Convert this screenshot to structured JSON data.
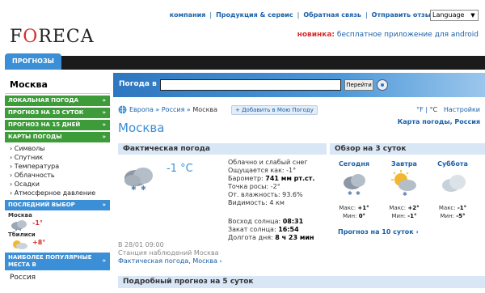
{
  "toplinks": [
    "компания",
    "Продукция & сервис",
    "Обратная связь",
    "Отправить отзыв"
  ],
  "language": "Language",
  "logo": "FORECA",
  "promo": {
    "new": "новинка:",
    "text": " бесплатное приложение для android"
  },
  "tab": "ПРОГНОЗЫ",
  "search": {
    "label": "Погода в",
    "button": "Перейти"
  },
  "sidebar": {
    "city": "Москва",
    "green": [
      {
        "label": "ЛОКАЛЬНАЯ ПОГОДА"
      },
      {
        "label": "ПРОГНОЗ НА 10 СУТОК"
      },
      {
        "label": "ПРОГНОЗ НА 15 ДНЕЙ"
      },
      {
        "label": "КАРТЫ ПОГОДЫ"
      }
    ],
    "sub": [
      "› Символы",
      "› Спутник",
      "› Температура",
      "› Облачность",
      "› Осадки",
      "› Атмосферное давление"
    ],
    "recent_title": "ПОСЛЕДНИЙ ВЫБОР",
    "recent": [
      {
        "name": "Москва",
        "temp": "-1°"
      },
      {
        "name": "Тбилиси",
        "temp": "+8°"
      }
    ],
    "popular_title": "НАИБОЛЕЕ ПОПУЛЯРНЫЕ МЕСТА В",
    "popular_country": "Россия"
  },
  "breadcrumb": {
    "path1": "Европа",
    "path2": "Россия",
    "current": "Москва",
    "favorite": "+ Добавить в Мою Погоду",
    "unit_f": "°F",
    "unit_c": "°C",
    "settings": "Настройки"
  },
  "title": "Москва",
  "maplink": "Карта погоды, Россия",
  "current": {
    "heading": "Фактическая погода",
    "temp": "-1 °C",
    "details": [
      {
        "label": "Облачно и слабый снег",
        "value": ""
      },
      {
        "label": "Ощущается как: ",
        "value": "-1°"
      },
      {
        "label": "Барометр: ",
        "value": "741 мм рт.ст."
      },
      {
        "label": "Точка росы: ",
        "value": "-2°"
      },
      {
        "label": "От. влажность: ",
        "value": "93.6%"
      },
      {
        "label": "Видимость: ",
        "value": "4 км"
      }
    ],
    "sun": [
      {
        "label": "Восход солнца: ",
        "value": "08:31"
      },
      {
        "label": "Закат солнца: ",
        "value": "16:54"
      },
      {
        "label": "Долгота дня: ",
        "value": "8 ч 23 мин"
      }
    ],
    "time": "В 28/01 09:00",
    "station": "Станция наблюдений Москва",
    "link": "Фактическая погода, Москва ›"
  },
  "overview": {
    "heading": "Обзор на 3 суток",
    "days": [
      {
        "name": "Сегодня",
        "max": "+1°",
        "min": "0°"
      },
      {
        "name": "Завтра",
        "max": "+2°",
        "min": "-1°"
      },
      {
        "name": "Суббота",
        "max": "-1°",
        "min": "-5°"
      }
    ],
    "max_label": "Макс: ",
    "min_label": "Мин: ",
    "link10": "Прогноз на 10 суток ›"
  },
  "forecast5": "Подробный прогноз на 5 суток"
}
